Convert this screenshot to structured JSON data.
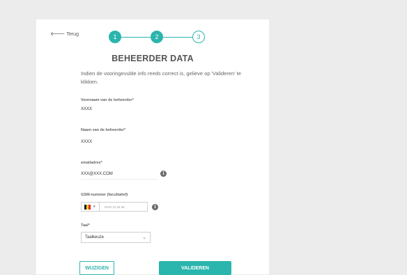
{
  "nav": {
    "back_label": "Terug"
  },
  "stepper": {
    "steps": [
      "1",
      "2",
      "3"
    ],
    "current": 2
  },
  "title": "BEHEERDER DATA",
  "intro": "Indien de vooringevulde info reeds correct is, gelieve op 'Valideren' te klikken.",
  "fields": {
    "firstname": {
      "label": "Voornaam van de beheerder*",
      "value": "XXXX"
    },
    "lastname": {
      "label": "Naam van de beheerder*",
      "value": "XXXX"
    },
    "email": {
      "label": "emailadres*",
      "value": "XXX@XXX.COM"
    },
    "phone": {
      "label": "GSM-nummer (facultatief)",
      "placeholder": "0470 12 34 56",
      "country_flag": "be-flag-icon"
    },
    "language": {
      "label": "Taal*",
      "value": "Taalkeuze"
    }
  },
  "buttons": {
    "change": "WIJZIGEN",
    "validate": "VALIDEREN"
  },
  "colors": {
    "accent": "#2ab5ad",
    "background": "#ececec",
    "card": "#ffffff"
  }
}
